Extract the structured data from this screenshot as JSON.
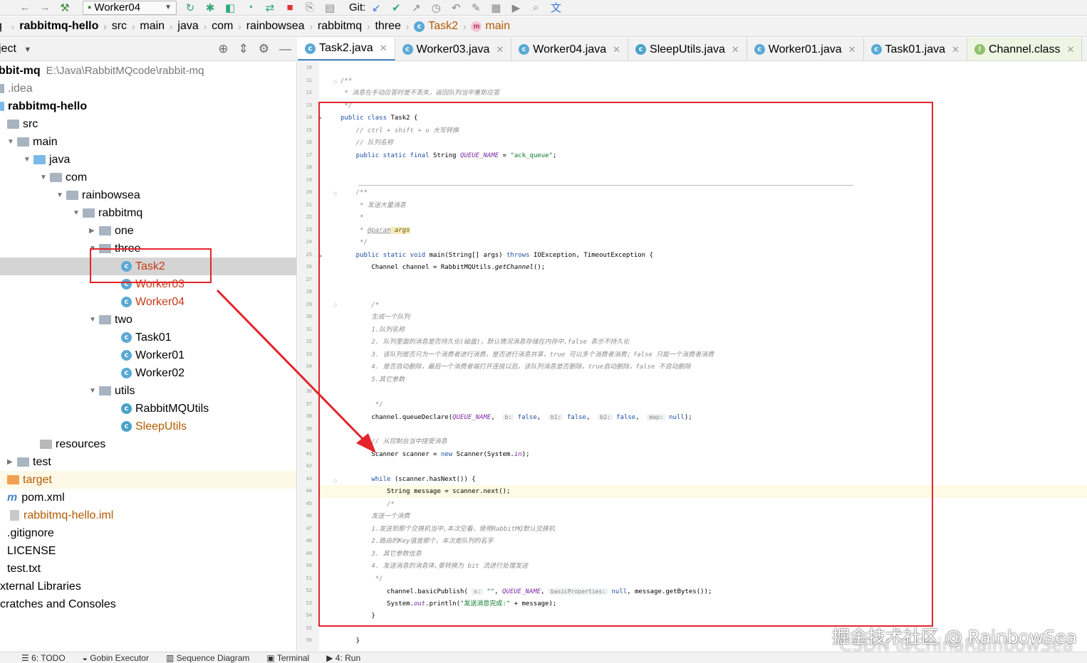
{
  "toolbar": {
    "run_config": "Worker04",
    "git_label": "Git:"
  },
  "breadcrumb": [
    "rabbitmq-hello",
    "src",
    "main",
    "java",
    "com",
    "rainbowsea",
    "rabbitmq",
    "three",
    "Task2",
    "main"
  ],
  "project_panel": {
    "title": "ject",
    "root_name": "bbit-mq",
    "root_path": "E:\\Java\\RabbitMQcode\\rabbit-mq"
  },
  "tree": [
    {
      "label": ".idea",
      "style": "gray"
    },
    {
      "label": "rabbitmq-hello",
      "style": "bold"
    },
    {
      "label": "src"
    },
    {
      "label": "main"
    },
    {
      "label": "java"
    },
    {
      "label": "com"
    },
    {
      "label": "rainbowsea"
    },
    {
      "label": "rabbitmq"
    },
    {
      "label": "one"
    },
    {
      "label": "three"
    },
    {
      "label": "Task2",
      "style": "red"
    },
    {
      "label": "Worker03",
      "style": "red"
    },
    {
      "label": "Worker04",
      "style": "red"
    },
    {
      "label": "two"
    },
    {
      "label": "Task01"
    },
    {
      "label": "Worker01"
    },
    {
      "label": "Worker02"
    },
    {
      "label": "utils"
    },
    {
      "label": "RabbitMQUtils"
    },
    {
      "label": "SleepUtils",
      "style": "orange"
    },
    {
      "label": "resources"
    },
    {
      "label": "test"
    },
    {
      "label": "target",
      "style": "orange"
    },
    {
      "label": "pom.xml"
    },
    {
      "label": "rabbitmq-hello.iml",
      "style": "orange"
    },
    {
      "label": ".gitignore"
    },
    {
      "label": "LICENSE"
    },
    {
      "label": "test.txt"
    },
    {
      "label": "xternal Libraries"
    },
    {
      "label": "cratches and Consoles"
    }
  ],
  "tabs": [
    "Task2.java",
    "Worker03.java",
    "Worker04.java",
    "SleepUtils.java",
    "Worker01.java",
    "Task01.java",
    "Channel.class"
  ],
  "line_numbers": [
    "10",
    "11",
    "12",
    "13",
    "14",
    "15",
    "16",
    "17",
    "18",
    "19",
    "20",
    "21",
    "22",
    "23",
    "24",
    "25",
    "26",
    "27",
    "28",
    "29",
    "30",
    "31",
    "32",
    "33",
    "34",
    "36",
    "37",
    "38",
    "39",
    "40",
    "41",
    "42",
    "43",
    "44",
    "45",
    "46",
    "47",
    "48",
    "49",
    "50",
    "51",
    "52",
    "53",
    "54",
    "55",
    "56"
  ],
  "code": {
    "l11": "/**",
    "l12": " * 消息在手动应答时是不丢失，返回队列当中重新应答",
    "l13": " */",
    "l14_kw": "public class",
    "l14_rest": " Task2 {",
    "l15": "    // ctrl + shift + u 大写转换",
    "l16": "    // 队列名称",
    "l17_kw": "    public static final",
    "l17_type": " String ",
    "l17_const": "QUEUE_NAME",
    "l17_eq": " = ",
    "l17_str": "\"ack_queue\"",
    "l17_end": ";",
    "l20": "    /**",
    "l21": "     * 发送大量消息",
    "l22": "     *",
    "l23_a": "     * ",
    "l23_tag": "@param",
    "l23_arg": " args",
    "l24": "     */",
    "l25_kw": "    public static void",
    "l25_name": " main",
    "l25_mid": "(String[] args) ",
    "l25_throws": "throws",
    "l25_end": " IOException, TimeoutException {",
    "l26_a": "        Channel channel = RabbitMQUtils.",
    "l26_m": "getChannel",
    "l26_b": "();",
    "l29": "        /*",
    "l30": "        生成一个队列",
    "l31": "        1.队列名称",
    "l32": "        2. 队列里面的消息是否持久化(磁盘)，默认情况消息存储在内存中,false 表示不持久化",
    "l33": "        3. 该队列是否只为一个消费者进行消费，是否进行消息共享，true 可以多个消费者消费；false 只能一个消费者消费",
    "l34": "        4. 是否自动删除，最后一个消费者端打开连接以后，该队列消息是否删除，true自动删除，false 不自动删除",
    "l35": "        5.其它参数",
    "l36": "         */",
    "l37_a": "        channel.queueDeclare(",
    "l37_c": "QUEUE_NAME",
    "l37_b": ",  ",
    "l37_h1": "b:",
    "l37_v1": " false",
    "l37_h2": "b1:",
    "l37_v2": " false",
    "l37_h3": "b2:",
    "l37_v3": " false",
    "l37_h4": "map:",
    "l37_v4": " null",
    "l37_end": ");",
    "l39": "        // 从控制台当中接受消息",
    "l40_a": "        Scanner scanner = ",
    "l40_kw": "new",
    "l40_b": " Scanner(System.",
    "l40_in": "in",
    "l40_c": ");",
    "l42_kw": "        while",
    "l42_b": " (scanner.hasNext()) {",
    "l43": "            String message = scanner.next();",
    "l44": "            /*",
    "l45": "        发送一个消费",
    "l46": "        1.发送到那个交换机当中,本次空着，使用RabbitMQ默认交换机",
    "l47": "        2.路由的Key值是那个，本次是队列的名字",
    "l48": "        3. 其它参数信息",
    "l49": "        4. 发送消息的消息体,要转换为 bit 流进行处理发送",
    "l50": "         */",
    "l51_a": "            channel.basicPublish( ",
    "l51_h1": "s:",
    "l51_s": " \"\"",
    "l51_b": ", ",
    "l51_c": "QUEUE_NAME",
    "l51_d": ", ",
    "l51_h2": "basicProperties:",
    "l51_v": " null",
    "l51_e": ", message.getBytes());",
    "l52_a": "            System.",
    "l52_out": "out",
    "l52_b": ".println(",
    "l52_str": "\"发送消息完成:\"",
    "l52_c": " + message);",
    "l53": "        }",
    "l55": "    }"
  },
  "statusbar": [
    "6: TODO",
    "Gobin Executor",
    "Sequence Diagram",
    "Terminal",
    "4: Run"
  ],
  "watermark": {
    "line1": "掘金技术社区 @ RainbowSea",
    "line2": "CSDN @ChinaRainbowSea"
  },
  "colors": {
    "annotation_red": "#e3242b",
    "keyword": "#1d4fa5",
    "string": "#0a7a2a",
    "comment": "#8c8c8c",
    "constant": "#7a2aa5"
  }
}
